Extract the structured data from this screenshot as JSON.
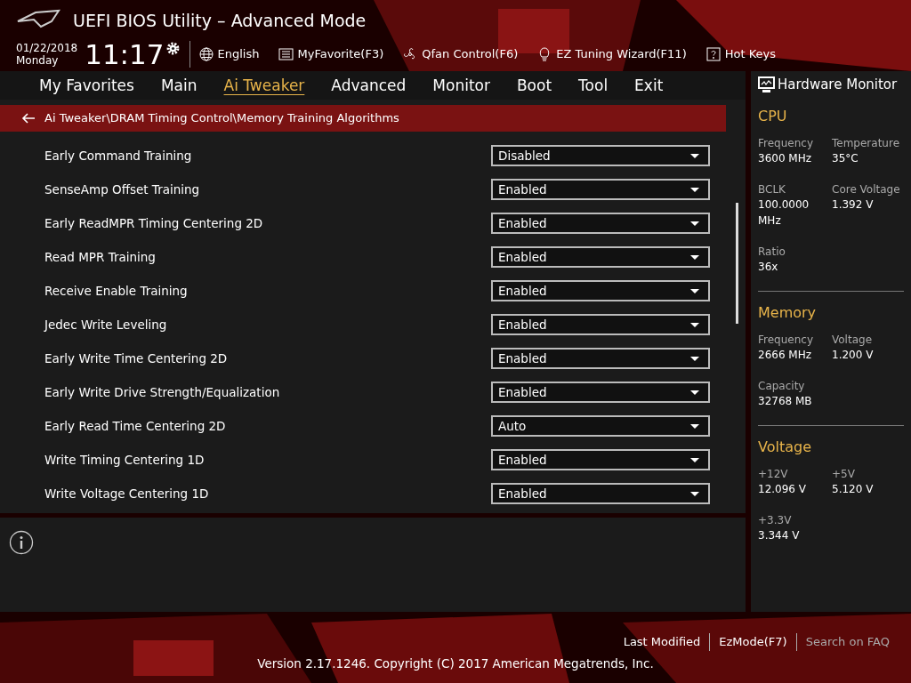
{
  "header": {
    "title": "UEFI BIOS Utility – Advanced Mode",
    "date": "01/22/2018",
    "day": "Monday",
    "time": "11:17",
    "tools": [
      {
        "kind": "globe",
        "label": "English"
      },
      {
        "kind": "list",
        "label": "MyFavorite(F3)"
      },
      {
        "kind": "fan",
        "label": "Qfan Control(F6)"
      },
      {
        "kind": "bulb",
        "label": "EZ Tuning Wizard(F11)"
      },
      {
        "kind": "help",
        "label": "Hot Keys"
      }
    ]
  },
  "menu": [
    {
      "label": "My Favorites",
      "selected": false
    },
    {
      "label": "Main",
      "selected": false
    },
    {
      "label": "Ai Tweaker",
      "selected": true
    },
    {
      "label": "Advanced",
      "selected": false
    },
    {
      "label": "Monitor",
      "selected": false
    },
    {
      "label": "Boot",
      "selected": false
    },
    {
      "label": "Tool",
      "selected": false
    },
    {
      "label": "Exit",
      "selected": false
    }
  ],
  "breadcrumb": "Ai Tweaker\\DRAM Timing Control\\Memory Training Algorithms",
  "settings": [
    {
      "label": "Early Command Training",
      "value": "Disabled"
    },
    {
      "label": "SenseAmp Offset Training",
      "value": "Enabled"
    },
    {
      "label": "Early ReadMPR Timing Centering 2D",
      "value": "Enabled"
    },
    {
      "label": "Read MPR Training",
      "value": "Enabled"
    },
    {
      "label": "Receive Enable Training",
      "value": "Enabled"
    },
    {
      "label": "Jedec Write Leveling",
      "value": "Enabled"
    },
    {
      "label": "Early Write Time Centering 2D",
      "value": "Enabled"
    },
    {
      "label": "Early Write Drive Strength/Equalization",
      "value": "Enabled"
    },
    {
      "label": "Early Read Time Centering 2D",
      "value": "Auto"
    },
    {
      "label": "Write Timing Centering 1D",
      "value": "Enabled"
    },
    {
      "label": "Write Voltage Centering 1D",
      "value": "Enabled"
    }
  ],
  "monitor": {
    "title": "Hardware Monitor",
    "sections": [
      {
        "title": "CPU",
        "items": [
          {
            "label": "Frequency",
            "value": "3600 MHz"
          },
          {
            "label": "Temperature",
            "value": "35°C"
          },
          {
            "label": "BCLK",
            "value": "100.0000 MHz"
          },
          {
            "label": "Core Voltage",
            "value": "1.392 V"
          },
          {
            "label": "Ratio",
            "value": "36x"
          }
        ]
      },
      {
        "title": "Memory",
        "items": [
          {
            "label": "Frequency",
            "value": "2666 MHz"
          },
          {
            "label": "Voltage",
            "value": "1.200 V"
          },
          {
            "label": "Capacity",
            "value": "32768 MB"
          }
        ]
      },
      {
        "title": "Voltage",
        "items": [
          {
            "label": "+12V",
            "value": "12.096 V"
          },
          {
            "label": "+5V",
            "value": "5.120 V"
          },
          {
            "label": "+3.3V",
            "value": "3.344 V"
          }
        ]
      }
    ]
  },
  "footer": {
    "links": [
      "Last Modified",
      "EzMode(F7)",
      "Search on FAQ"
    ],
    "copyright": "Version 2.17.1246. Copyright (C) 2017 American Megatrends, Inc."
  }
}
